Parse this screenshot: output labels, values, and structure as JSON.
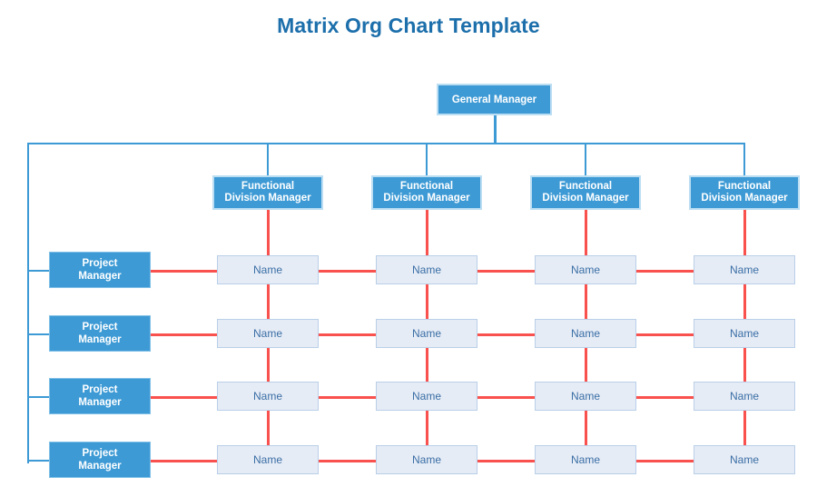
{
  "title": "Matrix Org Chart Template",
  "colors": {
    "title": "#1c6fab",
    "node_blue": "#3d9ad5",
    "node_blue_border": "#bcdef3",
    "cell_fill": "#e6ecf6",
    "cell_border": "#b9cfe8",
    "cell_text": "#3a6ea5",
    "connector_blue": "#3d9ad5",
    "connector_red": "#f9514d",
    "background": "#ffffff"
  },
  "top": {
    "general_manager": "General Manager"
  },
  "functional_managers": [
    {
      "label": "Functional\nDivision Manager"
    },
    {
      "label": "Functional\nDivision Manager"
    },
    {
      "label": "Functional\nDivision Manager"
    },
    {
      "label": "Functional\nDivision Manager"
    }
  ],
  "project_managers": [
    {
      "label": "Project\nManager"
    },
    {
      "label": "Project\nManager"
    },
    {
      "label": "Project\nManager"
    },
    {
      "label": "Project\nManager"
    }
  ],
  "matrix": {
    "rows": [
      {
        "cells": [
          "Name",
          "Name",
          "Name",
          "Name"
        ]
      },
      {
        "cells": [
          "Name",
          "Name",
          "Name",
          "Name"
        ]
      },
      {
        "cells": [
          "Name",
          "Name",
          "Name",
          "Name"
        ]
      },
      {
        "cells": [
          "Name",
          "Name",
          "Name",
          "Name"
        ]
      }
    ]
  }
}
